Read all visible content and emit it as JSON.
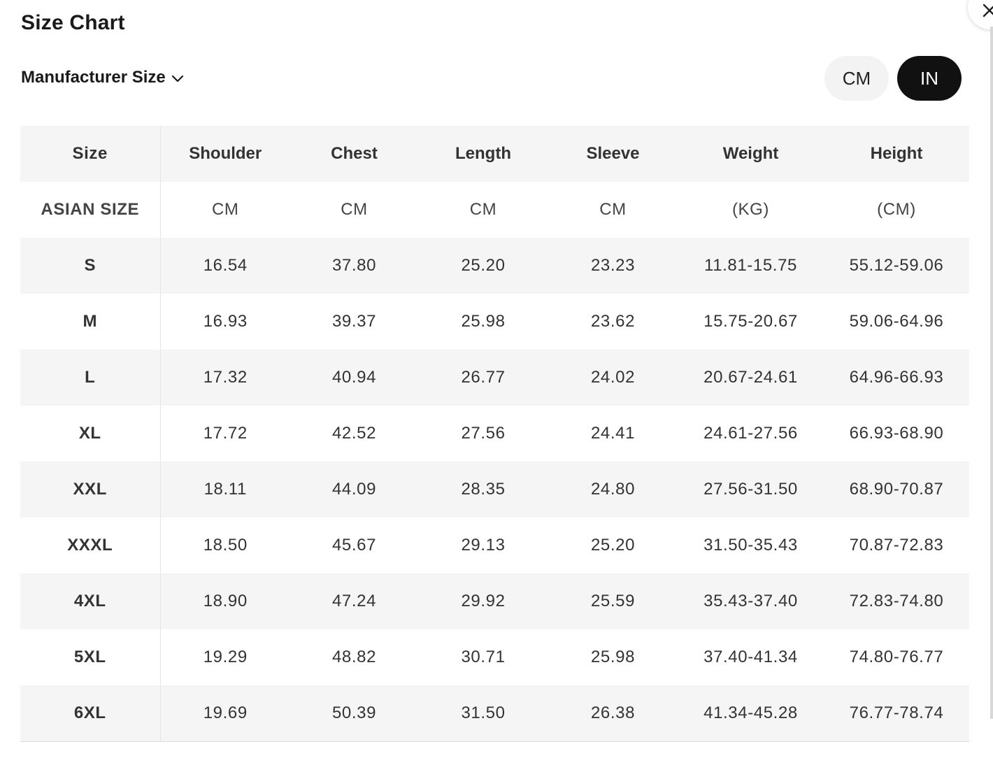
{
  "title": "Size Chart",
  "size_selector": {
    "label": "Manufacturer Size",
    "icon": "chevron-down-icon"
  },
  "unit_toggle": {
    "options": [
      "CM",
      "IN"
    ],
    "selected": "IN"
  },
  "close": {
    "icon": "close-icon"
  },
  "colors": {
    "selected_bg": "#111111",
    "unselected_bg": "#f3f3f3",
    "row_shade": "#f5f5f5"
  },
  "table": {
    "headers": [
      "Size",
      "Shoulder",
      "Chest",
      "Length",
      "Sleeve",
      "Weight",
      "Height"
    ],
    "units": [
      "ASIAN SIZE",
      "CM",
      "CM",
      "CM",
      "CM",
      "(KG)",
      "(CM)"
    ],
    "rows": [
      [
        "S",
        "16.54",
        "37.80",
        "25.20",
        "23.23",
        "11.81-15.75",
        "55.12-59.06"
      ],
      [
        "M",
        "16.93",
        "39.37",
        "25.98",
        "23.62",
        "15.75-20.67",
        "59.06-64.96"
      ],
      [
        "L",
        "17.32",
        "40.94",
        "26.77",
        "24.02",
        "20.67-24.61",
        "64.96-66.93"
      ],
      [
        "XL",
        "17.72",
        "42.52",
        "27.56",
        "24.41",
        "24.61-27.56",
        "66.93-68.90"
      ],
      [
        "XXL",
        "18.11",
        "44.09",
        "28.35",
        "24.80",
        "27.56-31.50",
        "68.90-70.87"
      ],
      [
        "XXXL",
        "18.50",
        "45.67",
        "29.13",
        "25.20",
        "31.50-35.43",
        "70.87-72.83"
      ],
      [
        "4XL",
        "18.90",
        "47.24",
        "29.92",
        "25.59",
        "35.43-37.40",
        "72.83-74.80"
      ],
      [
        "5XL",
        "19.29",
        "48.82",
        "30.71",
        "25.98",
        "37.40-41.34",
        "74.80-76.77"
      ],
      [
        "6XL",
        "19.69",
        "50.39",
        "31.50",
        "26.38",
        "41.34-45.28",
        "76.77-78.74"
      ]
    ]
  }
}
